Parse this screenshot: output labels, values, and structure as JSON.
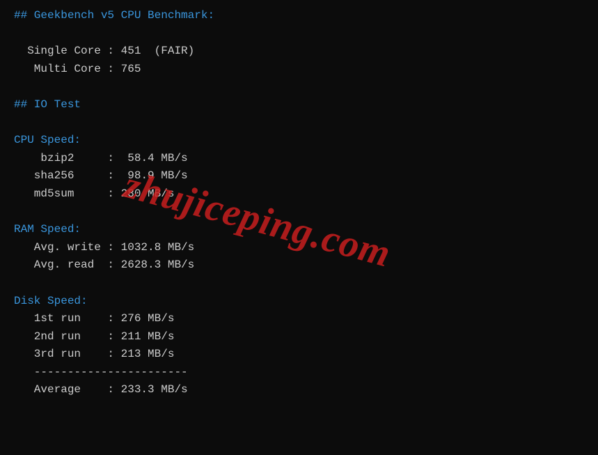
{
  "geekbench": {
    "title": "## Geekbench v5 CPU Benchmark:",
    "single_core_label": "  Single Core : ",
    "single_core_value": "451  (FAIR)",
    "multi_core_label": "   Multi Core : ",
    "multi_core_value": "765"
  },
  "io_test": {
    "title": "## IO Test"
  },
  "cpu_speed": {
    "title": "CPU Speed:",
    "bzip2_label": "    bzip2     :  ",
    "bzip2_value": "58.4 MB/s",
    "sha256_label": "   sha256     :  ",
    "sha256_value": "98.9 MB/s",
    "md5sum_label": "   md5sum     : ",
    "md5sum_value": "280 MB/s"
  },
  "ram_speed": {
    "title": "RAM Speed:",
    "write_label": "   Avg. write : ",
    "write_value": "1032.8 MB/s",
    "read_label": "   Avg. read  : ",
    "read_value": "2628.3 MB/s"
  },
  "disk_speed": {
    "title": "Disk Speed:",
    "run1_label": "   1st run    : ",
    "run1_value": "276 MB/s",
    "run2_label": "   2nd run    : ",
    "run2_value": "211 MB/s",
    "run3_label": "   3rd run    : ",
    "run3_value": "213 MB/s",
    "divider": "   -----------------------",
    "avg_label": "   Average    : ",
    "avg_value": "233.3 MB/s"
  },
  "watermark": "zhujiceping.com"
}
